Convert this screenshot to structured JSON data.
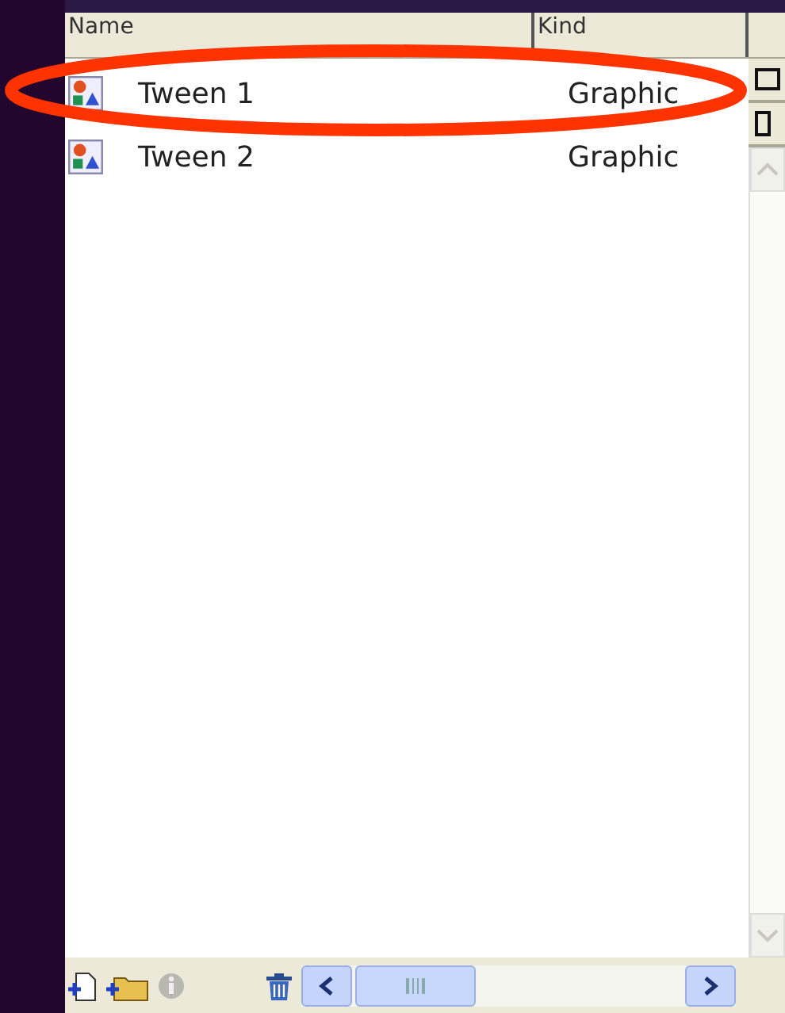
{
  "table": {
    "columns": [
      "Name",
      "Kind"
    ],
    "rows": [
      {
        "name": "Tween 1",
        "kind": "Graphic"
      },
      {
        "name": "Tween 2",
        "kind": "Graphic"
      }
    ]
  }
}
